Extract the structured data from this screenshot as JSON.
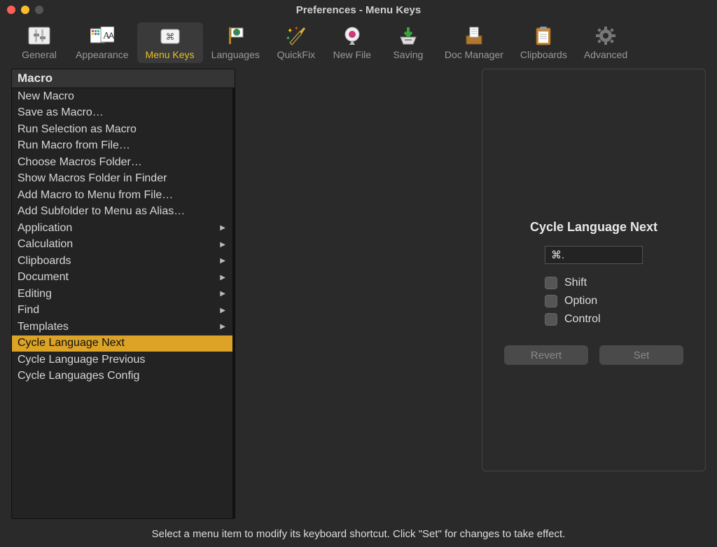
{
  "window": {
    "title": "Preferences - Menu Keys"
  },
  "toolbar": {
    "items": [
      {
        "label": "General"
      },
      {
        "label": "Appearance"
      },
      {
        "label": "Menu Keys",
        "selected": true
      },
      {
        "label": "Languages"
      },
      {
        "label": "QuickFix"
      },
      {
        "label": "New File"
      },
      {
        "label": "Saving"
      },
      {
        "label": "Doc Manager"
      },
      {
        "label": "Clipboards"
      },
      {
        "label": "Advanced"
      }
    ]
  },
  "left": {
    "header": "Macro",
    "items": [
      {
        "label": "New Macro"
      },
      {
        "label": "Save as Macro…"
      },
      {
        "label": "Run Selection as Macro"
      },
      {
        "label": "Run Macro from File…"
      },
      {
        "label": "Choose Macros Folder…"
      },
      {
        "label": "Show Macros Folder in Finder"
      },
      {
        "label": "Add Macro to Menu from File…"
      },
      {
        "label": "Add Subfolder to Menu as Alias…"
      },
      {
        "label": "Application",
        "submenu": true
      },
      {
        "label": "Calculation",
        "submenu": true
      },
      {
        "label": "Clipboards",
        "submenu": true
      },
      {
        "label": "Document",
        "submenu": true
      },
      {
        "label": "Editing",
        "submenu": true
      },
      {
        "label": "Find",
        "submenu": true
      },
      {
        "label": "Templates",
        "submenu": true
      },
      {
        "label": "Cycle Language Next",
        "selected": true
      },
      {
        "label": "Cycle Language Previous"
      },
      {
        "label": "Cycle Languages Config"
      }
    ]
  },
  "panel": {
    "title": "Cycle Language Next",
    "shortcut": "⌘.",
    "modifiers": {
      "shift": "Shift",
      "option": "Option",
      "control": "Control"
    },
    "buttons": {
      "revert": "Revert",
      "set": "Set"
    }
  },
  "footer": "Select a menu item to modify its keyboard shortcut.  Click \"Set\" for changes to take effect."
}
